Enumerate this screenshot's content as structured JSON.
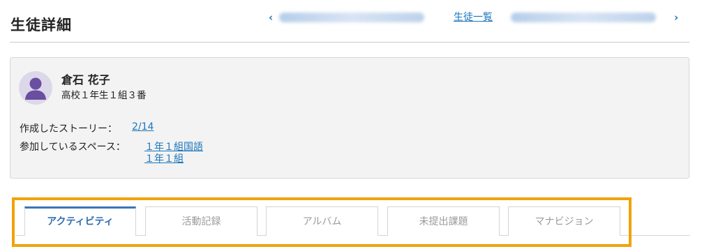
{
  "header": {
    "title": "生徒詳細",
    "prev_icon": "chevron-left-icon",
    "next_icon": "chevron-right-icon",
    "list_link": "生徒一覧"
  },
  "student": {
    "name": "倉石 花子",
    "grade": "高校１年生１組３番",
    "stories_label": "作成したストーリー：",
    "stories_value": "2/14",
    "spaces_label": "参加しているスペース：",
    "spaces": [
      "１年１組国語",
      "１年１組"
    ]
  },
  "tabs": [
    {
      "label": "アクティビティ",
      "active": true
    },
    {
      "label": "活動記録",
      "active": false
    },
    {
      "label": "アルバム",
      "active": false
    },
    {
      "label": "未提出課題",
      "active": false
    },
    {
      "label": "マナビジョン",
      "active": false
    }
  ],
  "colors": {
    "link": "#1b75bb",
    "active_tab": "#2d6fb1",
    "highlight_frame": "#f0a30a",
    "avatar_bg": "#ddd7ea",
    "avatar_fg": "#6a4ea0"
  }
}
